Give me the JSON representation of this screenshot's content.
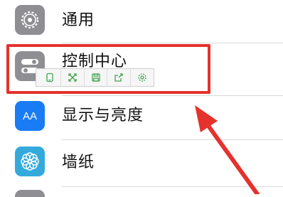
{
  "settings_rows": [
    {
      "label": "通用",
      "icon": "gear-icon"
    },
    {
      "label": "控制中心",
      "icon": "toggle-switches-icon"
    },
    {
      "label": "显示与亮度",
      "icon": "text-size-icon",
      "icon_text": "AA"
    },
    {
      "label": "墙纸",
      "icon": "flower-icon"
    }
  ],
  "toolbar": {
    "buttons": [
      "phone-icon",
      "expand-icon",
      "save-icon",
      "share-icon",
      "settings-icon"
    ]
  },
  "annotation": {
    "highlight_color": "#e5322d",
    "arrow_color": "#e5322d"
  },
  "colors": {
    "general_icon": "#8e8e93",
    "control_icon": "#8e8e93",
    "display_icon": "#1a7cf5",
    "wallpaper_icon": "#34aadc",
    "toolbar_icon": "#3fa34d"
  }
}
